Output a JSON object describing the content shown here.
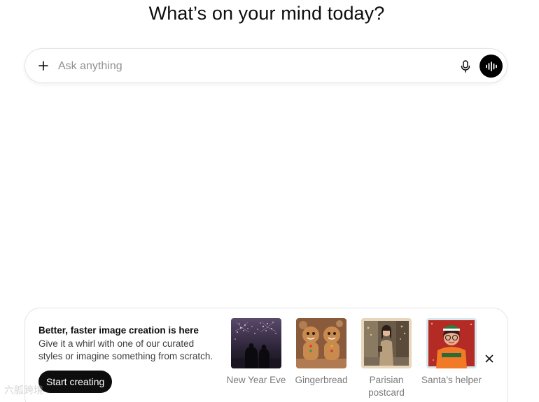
{
  "headline": "What’s on your mind today?",
  "composer": {
    "placeholder": "Ask anything",
    "value": "",
    "icons": {
      "attach": "plus-icon",
      "dictate": "microphone-icon",
      "voice": "voice-waveform-icon"
    }
  },
  "promo": {
    "title": "Better, faster image creation is here",
    "description": "Give it a whirl with one of our curated styles or imagine something from scratch.",
    "cta_label": "Start creating",
    "styles": [
      {
        "label": "New Year Eve"
      },
      {
        "label": "Gingerbread"
      },
      {
        "label": "Parisian postcard"
      },
      {
        "label": "Santa’s helper"
      }
    ],
    "close_icon": "close-icon"
  },
  "watermark": "六胍跨境"
}
